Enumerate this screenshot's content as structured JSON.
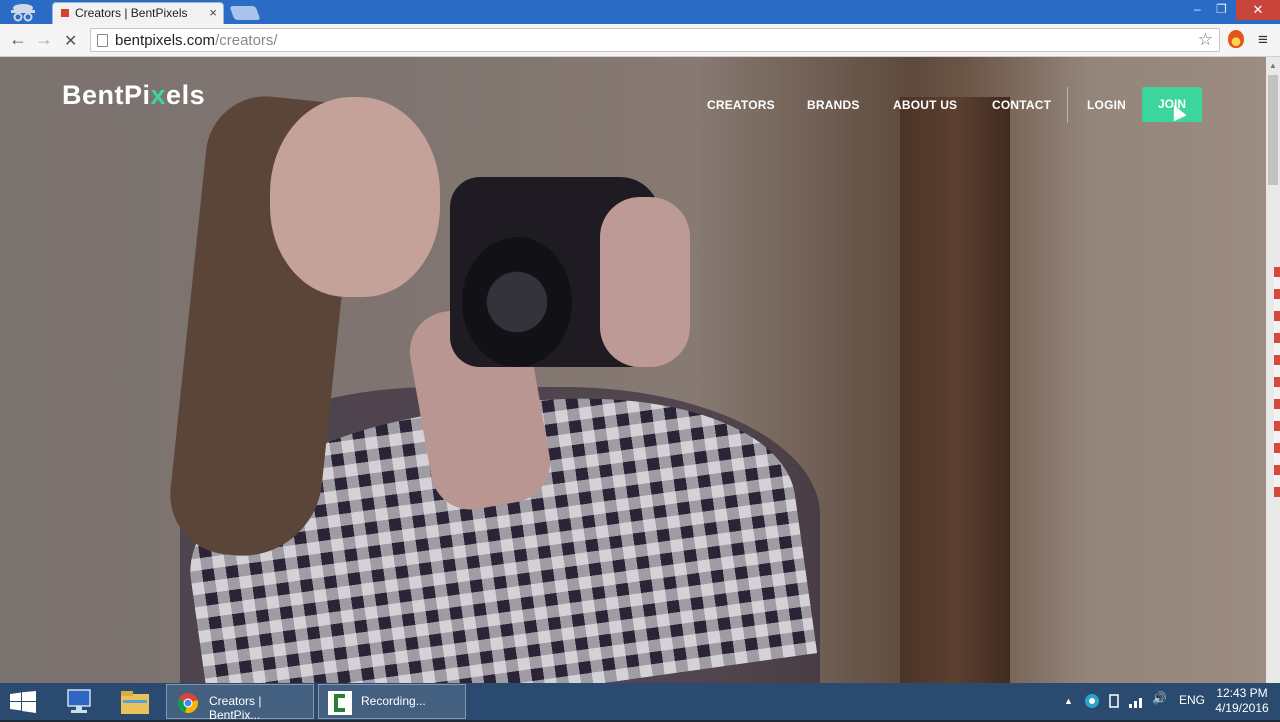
{
  "browser": {
    "tab_title": "Creators | BentPixels",
    "tab_close": "×",
    "url_host": "bentpixels.com",
    "url_path": "/creators/",
    "back_glyph": "←",
    "forward_glyph": "→",
    "stop_glyph": "✕",
    "star_glyph": "☆",
    "menu_glyph": "≡",
    "min_glyph": "–",
    "max_glyph": "❐",
    "close_glyph": "✕"
  },
  "site": {
    "logo_main": "BentPi",
    "logo_accent": "x",
    "logo_tail": "els",
    "nav": {
      "creators": "CREATORS",
      "brands": "BRANDS",
      "about": "ABOUT US",
      "contact": "CONTACT",
      "login": "LOGIN",
      "join": "JOIN"
    },
    "accent_color": "#3cd59b"
  },
  "taskbar": {
    "tasks": [
      {
        "label": "Creators | BentPix..."
      },
      {
        "label": "Recording..."
      }
    ],
    "tray": {
      "chevron": "▲",
      "lang": "ENG",
      "volume": "🔊"
    },
    "time": "12:43 PM",
    "date": "4/19/2016"
  }
}
